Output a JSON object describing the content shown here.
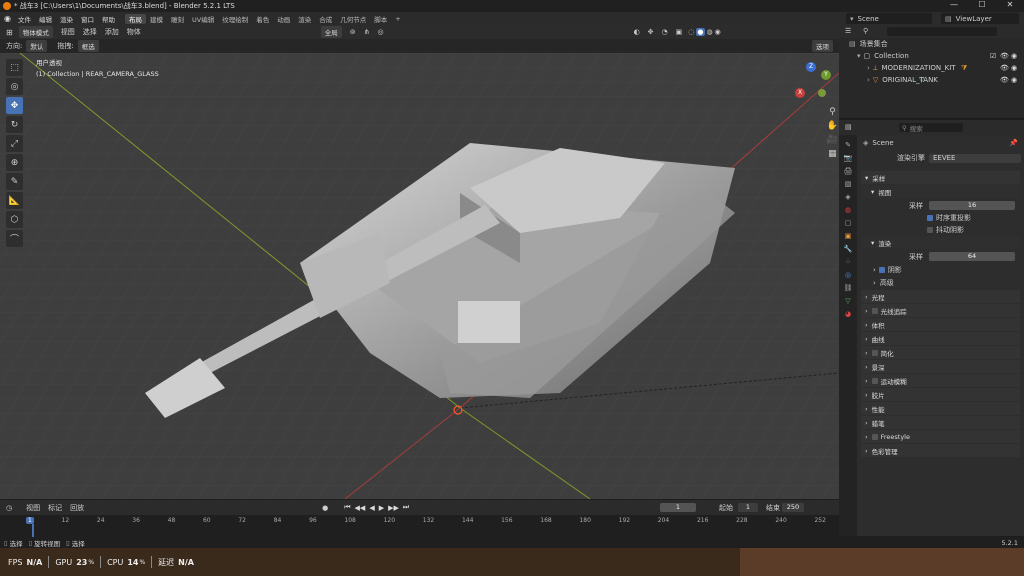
{
  "titlebar": {
    "title": "* 战车3 [C:\\Users\\1\\Documents\\战车3.blend] - Blender 5.2.1 LTS",
    "min": "—",
    "max": "☐",
    "close": "✕"
  },
  "menus": [
    "文件",
    "编辑",
    "渲染",
    "窗口",
    "帮助"
  ],
  "workspaces": [
    "布局",
    "建模",
    "雕刻",
    "UV编辑",
    "纹理绘制",
    "着色",
    "动画",
    "渲染",
    "合成",
    "几何节点",
    "脚本",
    "+"
  ],
  "scene": {
    "name": "Scene",
    "viewlayer": "ViewLayer"
  },
  "viewport_header": {
    "mode": "物体模式",
    "view": "视图",
    "select": "选择",
    "add": "添加",
    "object": "物体",
    "transform": "全局",
    "options": "选项"
  },
  "viewport_header2": {
    "orient_label": "方向:",
    "orient_value": "默认",
    "drag_label": "拖拽:",
    "drag_value": "框选"
  },
  "viewport": {
    "perspective": "用户透视",
    "active": "(1) Collection | REAR_CAMERA_GLASS",
    "gizmo": {
      "x": "X",
      "y": "Y",
      "z": "Z"
    }
  },
  "timeline_header": {
    "view": "视图",
    "marker": "标记",
    "playback": "回放",
    "frame": "1",
    "start_label": "起始",
    "start": "1",
    "end_label": "结束",
    "end": "250"
  },
  "timeline_ticks": [
    "1",
    "12",
    "24",
    "36",
    "48",
    "60",
    "72",
    "84",
    "96",
    "108",
    "120",
    "132",
    "144",
    "156",
    "168",
    "180",
    "192",
    "204",
    "216",
    "228",
    "240",
    "252"
  ],
  "statusbar": {
    "left1": "选择",
    "left2": "旋转视图",
    "left3": "选择",
    "version": "5.2.1"
  },
  "overlay": {
    "fps_label": "FPS",
    "fps": "N/A",
    "gpu_label": "GPU",
    "gpu": "23",
    "cpu_label": "CPU",
    "cpu": "14",
    "lat_label": "延迟",
    "lat": "N/A",
    "pct": "%"
  },
  "outliner": {
    "root": "场景集合",
    "collection": "Collection",
    "items": [
      "MODERNIZATION_KIT",
      "ORIGINAL_TANK"
    ]
  },
  "properties": {
    "search_placeholder": "搜索",
    "scene": "Scene",
    "engine_label": "渲染引擎",
    "engine": "EEVEE",
    "sampling": "采样",
    "viewport": "视图",
    "samples_label": "采样",
    "viewport_samples": "16",
    "temporal": "时序重投影",
    "jitter": "抖动阴影",
    "render": "渲染",
    "render_samples": "64",
    "shadows": "阴影",
    "advanced": "高级",
    "panels": [
      "光程",
      "光线追踪",
      "体积",
      "曲线",
      "简化",
      "景深",
      "运动模糊",
      "胶片",
      "性能",
      "蜡笔",
      "Freestyle",
      "色彩管理"
    ]
  }
}
